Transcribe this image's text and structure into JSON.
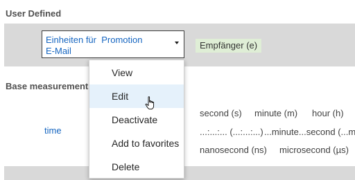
{
  "sections": {
    "user_defined": "User Defined",
    "base_measurements": "Base measurements"
  },
  "entity_select": {
    "value": "Einheiten für  Promotion\nE-Mail",
    "icon": "chevron-down-icon"
  },
  "recipient_tag": "Empfänger (e)",
  "unit": {
    "link": "time",
    "row1": [
      "second (s)",
      "minute (m)",
      "hour (h)"
    ],
    "row2": [
      "...:...:... (...:...:...)",
      "...minute...second (...m..."
    ],
    "row3": [
      "nanosecond (ns)",
      "microsecond (µs)"
    ]
  },
  "context_menu": {
    "items": [
      "View",
      "Edit",
      "Deactivate",
      "Add to favorites",
      "Delete"
    ],
    "hover_index": 1
  },
  "cursor": {
    "icon": "hand-pointer-icon"
  },
  "colors": {
    "link": "#1565c0",
    "band": "#d9d9d9",
    "tag": "#dfeed6",
    "menu_hover": "#e5f1fb"
  }
}
